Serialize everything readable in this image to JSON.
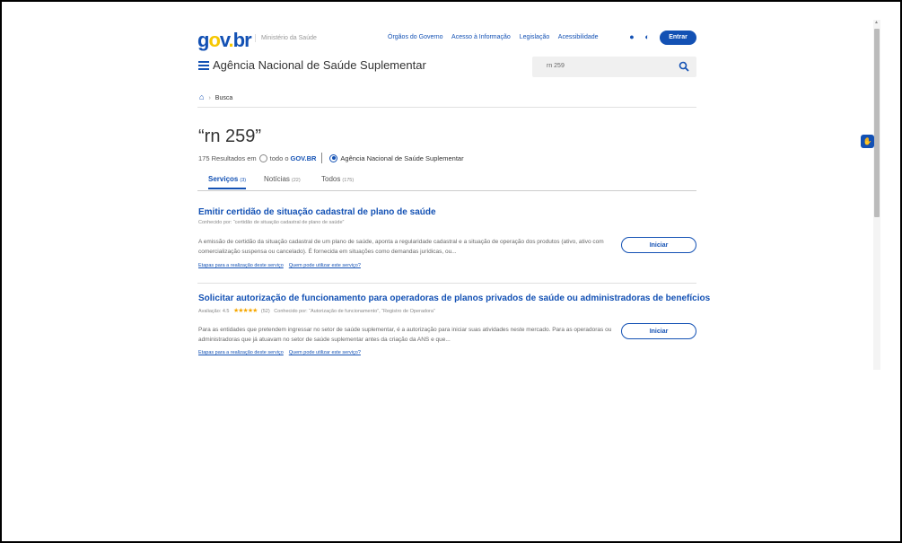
{
  "header": {
    "logo": {
      "g": "g",
      "o": "o",
      "v": "v",
      "dot": ".",
      "br": "br"
    },
    "ministry": "Ministério da Saúde",
    "links": [
      "Órgãos do Governo",
      "Acesso à Informação",
      "Legislação",
      "Acessibilidade"
    ],
    "login_label": "Entrar",
    "agency": "Agência Nacional de Saúde Suplementar",
    "search_value": "rn 259",
    "accent": "#1351b4"
  },
  "breadcrumb": {
    "current": "Busca"
  },
  "query": {
    "title": "“rn 259”",
    "count": "175",
    "results_label": "Resultados em",
    "scope_all_prefix": "todo o",
    "scope_all_brand": "GOV.BR",
    "scope_agency": "Agência Nacional de Saúde Suplementar"
  },
  "tabs": [
    {
      "label": "Serviços",
      "count": "(3)"
    },
    {
      "label": "Notícias",
      "count": "(22)"
    },
    {
      "label": "Todos",
      "count": "(175)"
    }
  ],
  "items": [
    {
      "title": "Emitir certidão de situação cadastral de plano de saúde",
      "meta": "Conhecido por: “certidão de situação cadastral de plano de saúde”",
      "desc": "A emissão de certidão da situação cadastral de um plano de saúde, aponta a regularidade cadastral e  a situação de operação dos produtos (ativo, ativo com comercialização suspensa ou cancelado). É fornecida em situações como demandas jurídicas, ou...",
      "link1": "Etapas para a realização deste serviço",
      "link2": "Quem pode utilizar este serviço?",
      "button": "Iniciar"
    },
    {
      "title": "Solicitar autorização de funcionamento para operadoras de planos privados de saúde ou administradoras de benefícios",
      "rating_label": "Avaliação:",
      "rating": "4.5",
      "stars": "★★★★★",
      "votes": "(52)",
      "meta": "Conhecido por: “Autorização de funcionamento”, “Registro de Operadora”",
      "desc": "Para as entidades que pretendem ingressar no setor de saúde suplementar, é a autorização para iniciar suas atividades neste mercado. Para as operadoras ou administradoras que já atuavam no setor de saúde suplementar antes da criação da ANS e que...",
      "link1": "Etapas para a realização deste serviço",
      "link2": "Quem pode utilizar este serviço?",
      "button": "Iniciar"
    }
  ]
}
